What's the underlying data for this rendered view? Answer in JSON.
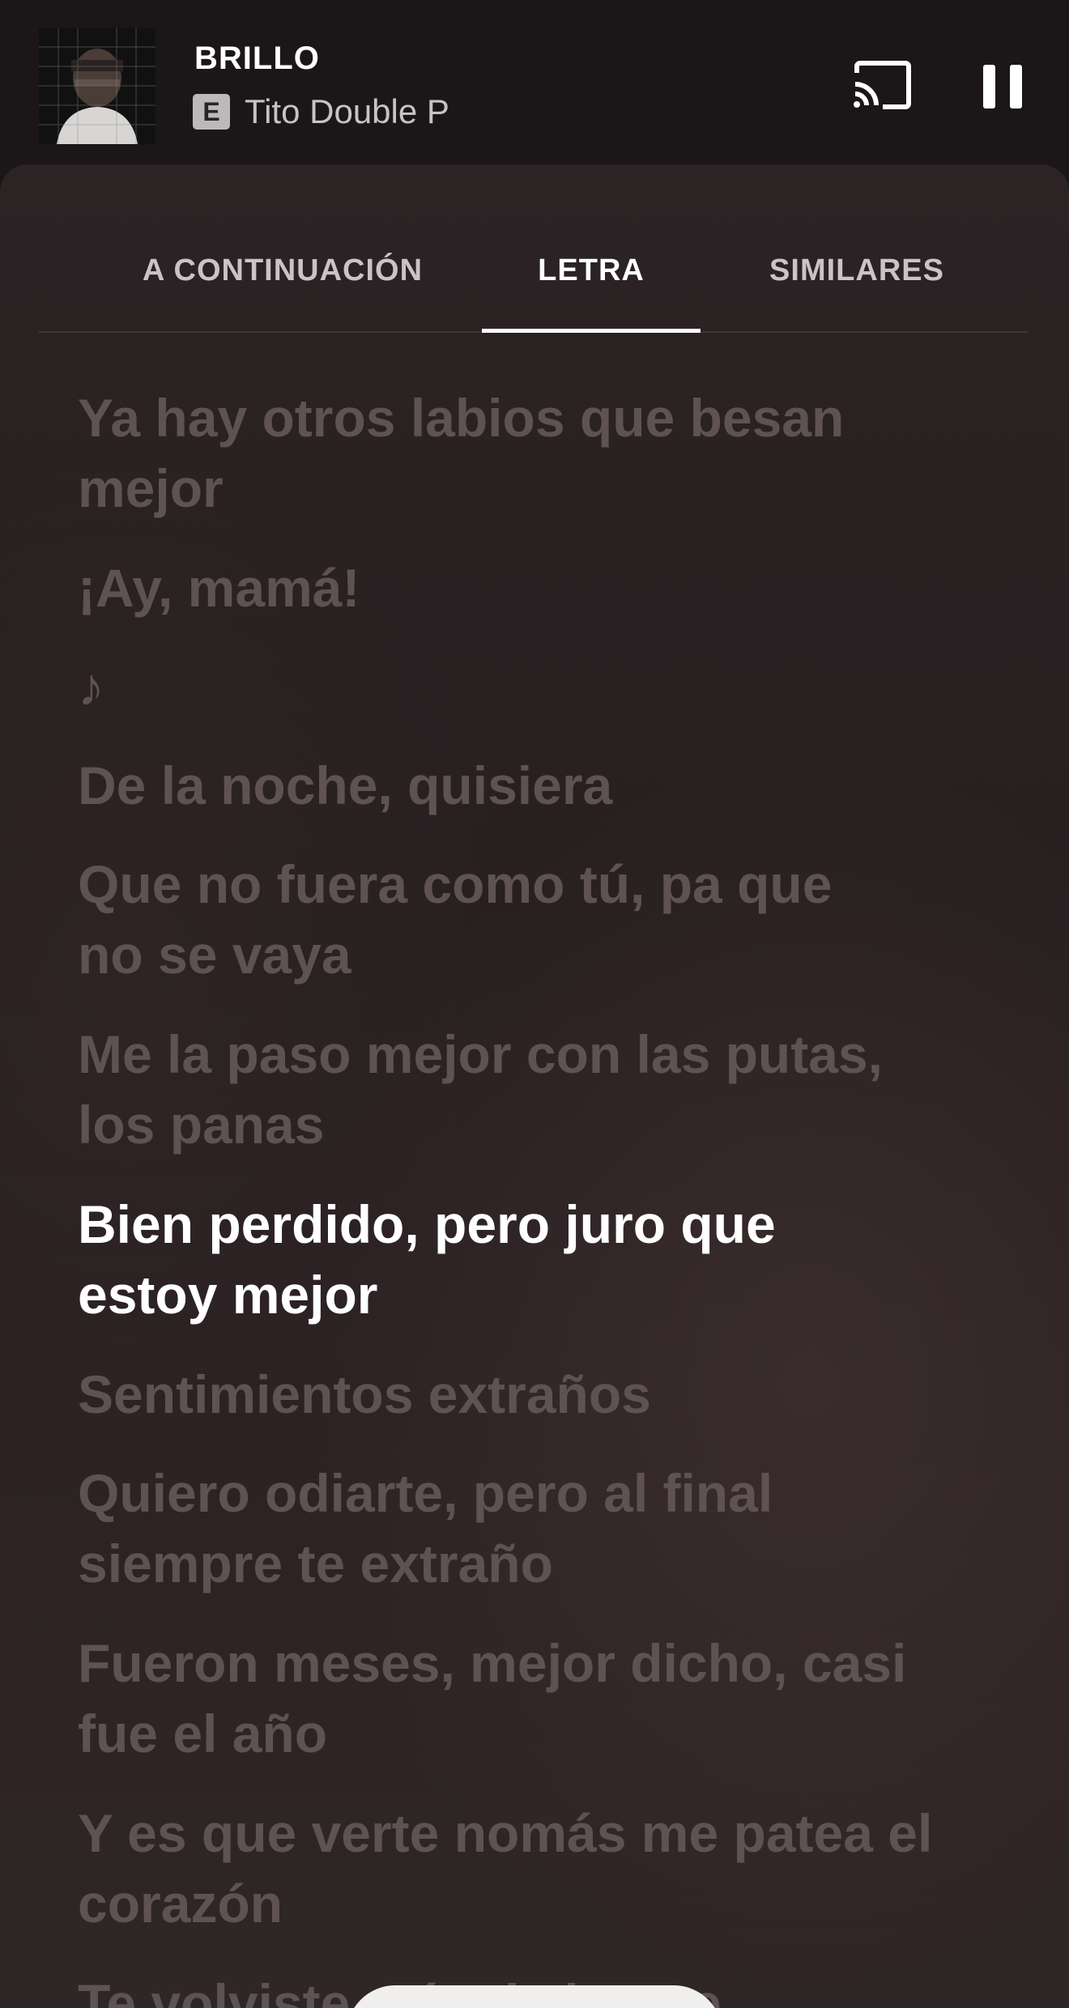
{
  "mini_player": {
    "title": "BRILLO",
    "explicit_label": "E",
    "artist": "Tito Double P",
    "cast_icon": "cast-icon",
    "pause_icon": "pause-icon"
  },
  "tabs": [
    {
      "label": "A CONTINUACIÓN",
      "active": false
    },
    {
      "label": "LETRA",
      "active": true
    },
    {
      "label": "SIMILARES",
      "active": false
    }
  ],
  "lyrics": {
    "current_index": 6,
    "lines": [
      "Ya hay otros labios que besan mejor",
      "¡Ay, mamá!",
      "♪",
      "De la noche, quisiera",
      "Que no fuera como tú, pa que no se vaya",
      "Me la paso mejor con las putas, los panas",
      "Bien perdido, pero juro que estoy mejor",
      "Sentimientos extraños",
      "Quiero odiarte, pero al final siempre te extraño",
      "Fueron meses, mejor dicho, casi fue el año",
      "Y es que verte nomás me patea el corazón",
      "Te volviste más de lo que"
    ]
  },
  "colors": {
    "background": "#1b1617",
    "sheet": "#2b2324",
    "lyric_inactive": "#5f5253",
    "lyric_active": "#ffffff",
    "tab_text": "#c9c4c5"
  }
}
